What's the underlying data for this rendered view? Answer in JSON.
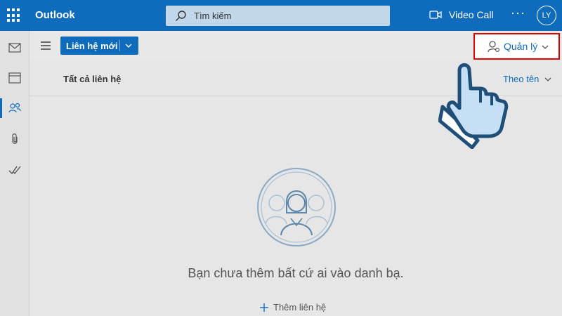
{
  "topbar": {
    "app_name": "Outlook",
    "search_placeholder": "Tìm kiếm",
    "video_call": "Video Call",
    "more": "···",
    "avatar_initials": "LY",
    "color": "#0f6cbd"
  },
  "rail": {
    "items": [
      "mail-icon",
      "calendar-icon",
      "people-icon",
      "attachment-icon",
      "todo-icon"
    ],
    "active": "people-icon"
  },
  "commands": {
    "new_contact": "Liên hệ mới",
    "manage": "Quản lý"
  },
  "list": {
    "title": "Tất cả liên hệ",
    "sort": "Theo tên"
  },
  "empty": {
    "message": "Bạn chưa thêm bất cứ ai vào danh bạ.",
    "add_contact": "Thêm liên hệ"
  },
  "colors": {
    "accent": "#0f6cbd",
    "highlight": "#e00000"
  }
}
